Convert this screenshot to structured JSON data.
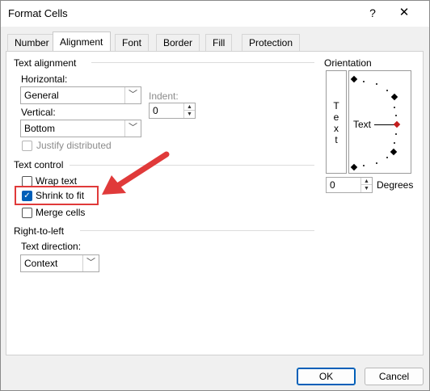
{
  "window": {
    "title": "Format Cells",
    "help_glyph": "?",
    "close_glyph": "✕"
  },
  "tabs": [
    "Number",
    "Alignment",
    "Font",
    "Border",
    "Fill",
    "Protection"
  ],
  "active_tab": "Alignment",
  "text_alignment": {
    "title": "Text alignment",
    "horizontal_label": "Horizontal:",
    "horizontal_value": "General",
    "vertical_label": "Vertical:",
    "vertical_value": "Bottom",
    "indent_label": "Indent:",
    "indent_value": "0",
    "justify_distributed": "Justify distributed"
  },
  "text_control": {
    "title": "Text control",
    "wrap_text": "Wrap text",
    "shrink_to_fit": "Shrink to fit",
    "shrink_to_fit_checked": true,
    "merge_cells": "Merge cells"
  },
  "rtl": {
    "title": "Right-to-left",
    "direction_label": "Text direction:",
    "direction_value": "Context"
  },
  "orientation": {
    "title": "Orientation",
    "vertical_text": "Text",
    "dial_text": "Text",
    "degrees_value": "0",
    "degrees_label": "Degrees"
  },
  "buttons": {
    "ok": "OK",
    "cancel": "Cancel"
  },
  "colors": {
    "annotation_red": "#e03a3a",
    "checkbox_blue": "#005fb8"
  }
}
